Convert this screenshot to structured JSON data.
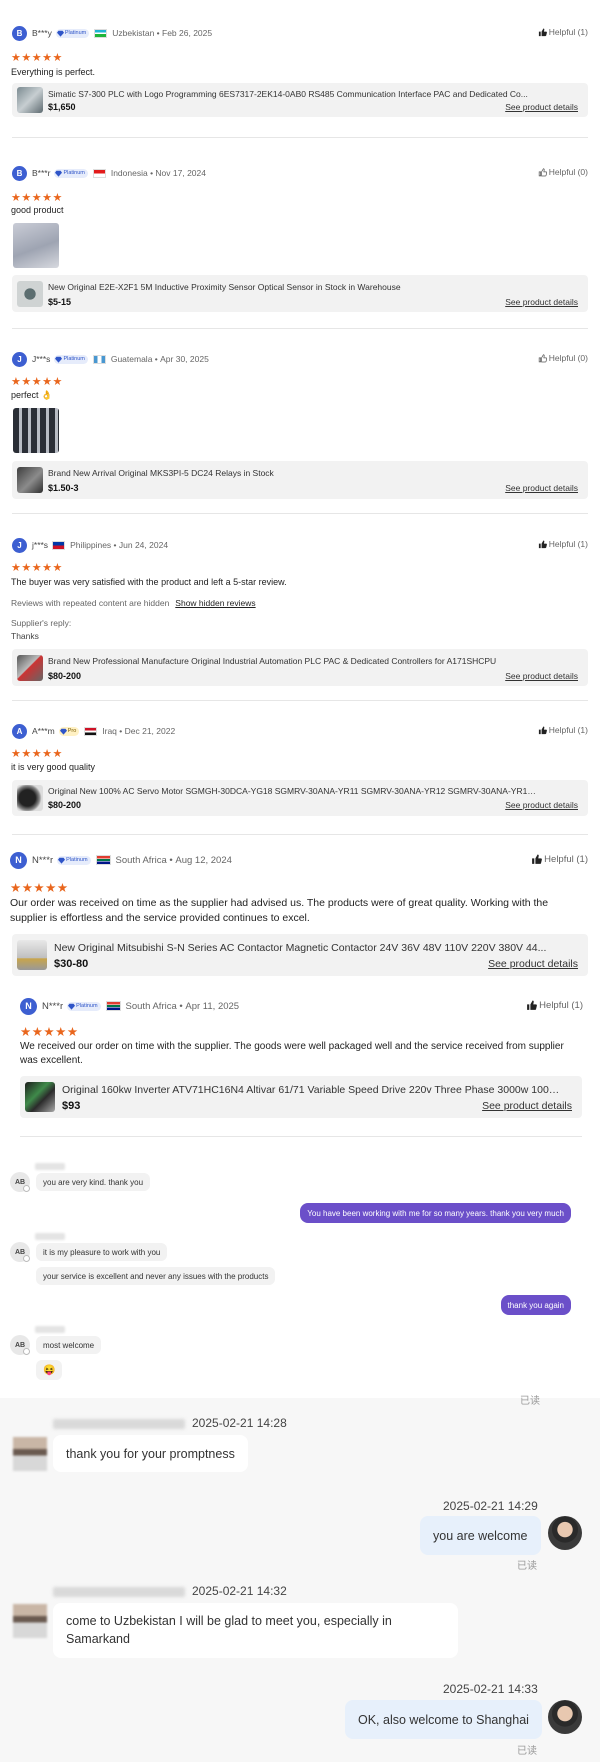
{
  "reviews": [
    {
      "initial": "B",
      "name": "B***y",
      "badge": "Platinum",
      "country": "Uzbekistan",
      "date": "Feb 26, 2025",
      "helpful": "Helpful (1)",
      "stars": "★★★★★",
      "text": "Everything is perfect.",
      "product": {
        "title": "Simatic S7-300 PLC with Logo Programming 6ES7317-2EK14-0AB0 RS485 Communication Interface PAC and Dedicated Co...",
        "price": "$1,650",
        "link": "See product details"
      }
    },
    {
      "initial": "B",
      "name": "B***r",
      "badge": "Platinum",
      "country": "Indonesia",
      "date": "Nov 17, 2024",
      "helpful": "Helpful (0)",
      "stars": "★★★★★",
      "text": "good product",
      "product": {
        "title": "New Original E2E-X2F1 5M Inductive Proximity Sensor Optical Sensor in Stock in Warehouse",
        "price": "$5-15",
        "link": "See product details"
      }
    },
    {
      "initial": "J",
      "name": "J***s",
      "badge": "Platinum",
      "country": "Guatemala",
      "date": "Apr 30, 2025",
      "helpful": "Helpful (0)",
      "stars": "★★★★★",
      "text": "perfect 👌",
      "product": {
        "title": "Brand New Arrival Original MKS3PI-5 DC24 Relays in Stock",
        "price": "$1.50-3",
        "link": "See product details"
      }
    },
    {
      "initial": "J",
      "name": "j***s",
      "country": "Philippines",
      "date": "Jun 24, 2024",
      "helpful": "Helpful (1)",
      "stars": "★★★★★",
      "text": "The buyer was very satisfied with the product and left a 5-star review.",
      "hidden_note": "Reviews with repeated content are hidden",
      "hidden_link": "Show hidden reviews",
      "reply_label": "Supplier's reply:",
      "reply_text": "Thanks",
      "product": {
        "title": "Brand New Professional Manufacture Original Industrial Automation PLC PAC & Dedicated Controllers for A171SHCPU",
        "price": "$80-200",
        "link": "See product details"
      }
    },
    {
      "initial": "A",
      "name": "A***m",
      "badge": "Pro",
      "country": "Iraq",
      "date": "Dec 21, 2022",
      "helpful": "Helpful (1)",
      "stars": "★★★★★",
      "text": "it is very good quality",
      "product": {
        "title": "Original New 100% AC Servo Motor SGMGH-30DCA-YG18 SGMRV-30ANA-YR11 SGMRV-30ANA-YR12 SGMRV-30ANA-YR13 I...",
        "price": "$80-200",
        "link": "See product details"
      }
    },
    {
      "initial": "N",
      "name": "N***r",
      "badge": "Platinum",
      "country": "South Africa",
      "date": "Aug 12, 2024",
      "helpful": "Helpful (1)",
      "stars": "★★★★★",
      "text": "Our order was received on time as the supplier had advised us. The products were of great quality. Working with the supplier is effortless and the service provided continues to excel.",
      "product": {
        "title": "New Original Mitsubishi S-N Series AC Contactor Magnetic Contactor 24V 36V 48V 110V 220V 380V 44...",
        "price": "$30-80",
        "link": "See product details"
      }
    },
    {
      "initial": "N",
      "name": "N***r",
      "badge": "Platinum",
      "country": "South Africa",
      "date": "Apr 11, 2025",
      "helpful": "Helpful (1)",
      "stars": "★★★★★",
      "text": "We received our order on time with the supplier. The goods were well packaged well and the service received from supplier was excellent.",
      "product": {
        "title": "Original 160kw Inverter ATV71HC16N4 Altivar 61/71 Variable Speed Drive 220v Three Phase 3000w 1000...",
        "price": "$93",
        "link": "See product details"
      }
    }
  ],
  "chat1": {
    "avatar_initials": "AB",
    "messages": [
      "you are very kind. thank you",
      "You have been working with me for so many years. thank you very much",
      "it is my pleasure to work with you",
      "your service is excellent and never any issues with the products",
      "thank you again",
      "most welcome",
      "😝"
    ]
  },
  "chat2": {
    "read_label": "已读",
    "messages": [
      {
        "time": "2025-02-21 14:28",
        "text": "thank you for your promptness"
      },
      {
        "time": "2025-02-21 14:29",
        "text": "you are welcome"
      },
      {
        "time": "2025-02-21 14:32",
        "text": "come to Uzbekistan I will be glad to meet you, especially in Samarkand"
      },
      {
        "time": "2025-02-21 14:33",
        "text": "OK, also welcome to Shanghai"
      }
    ]
  }
}
